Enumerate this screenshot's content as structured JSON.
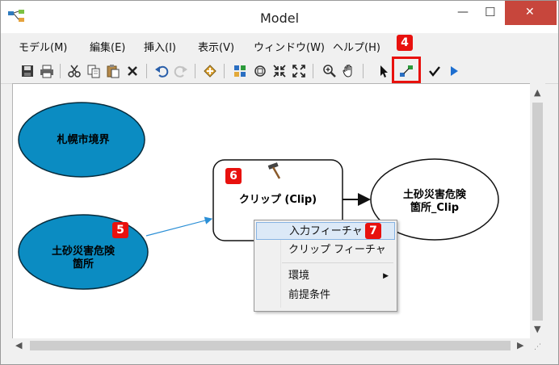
{
  "window": {
    "title": "Model",
    "controls": {
      "minimize": "—",
      "maximize": "☐",
      "close": "✕"
    }
  },
  "menubar": {
    "items": [
      {
        "label": "モデル(M)"
      },
      {
        "label": "編集(E)"
      },
      {
        "label": "挿入(I)"
      },
      {
        "label": "表示(V)"
      },
      {
        "label": "ウィンドウ(W)"
      },
      {
        "label": "ヘルプ(H)"
      }
    ]
  },
  "toolbar": {
    "icons": [
      "save-icon",
      "print-icon",
      "cut-icon",
      "copy-icon",
      "paste-icon",
      "delete-icon",
      "undo-icon",
      "redo-icon",
      "add-data-icon",
      "auto-layout-icon",
      "full-extent-icon",
      "zoom-in-icon",
      "zoom-out-icon",
      "pan-icon",
      "select-icon",
      "connect-icon",
      "validate-icon",
      "run-icon"
    ]
  },
  "badges": {
    "b4": "4",
    "b5": "5",
    "b6": "6",
    "b7": "7"
  },
  "diagram": {
    "nodes": {
      "input_boundary": "札幌市境界",
      "input_hazard_line1": "土砂災害危険",
      "input_hazard_line2": "箇所",
      "tool": "クリップ (Clip)",
      "output_line1": "土砂災害危険",
      "output_line2": "箇所_Clip"
    }
  },
  "context_menu": {
    "items": [
      {
        "label": "入力フィーチャ",
        "selected": true
      },
      {
        "label": "クリップ フィーチャ"
      },
      {
        "label": "環境",
        "has_submenu": true
      },
      {
        "label": "前提条件"
      }
    ]
  },
  "colors": {
    "input_fill": "#0b8cc2",
    "badge_red": "#e8110e",
    "close_button": "#c7463c",
    "connector_blue": "#2b8fd6",
    "menu_selected": "#dce9f7"
  }
}
